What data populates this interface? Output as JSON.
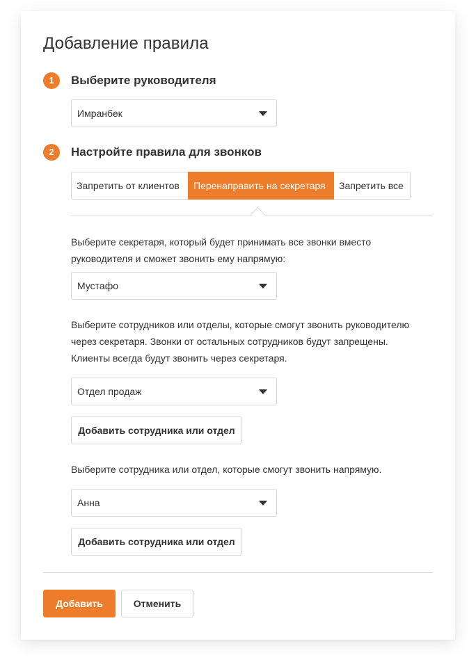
{
  "page": {
    "title": "Добавление правила"
  },
  "step1": {
    "number": "1",
    "title": "Выберите руководителя",
    "manager_select": "Имранбек"
  },
  "step2": {
    "number": "2",
    "title": "Настройте правила для звонков",
    "tabs": [
      {
        "label": "Запретить от клиентов",
        "active": false
      },
      {
        "label": "Перенаправить на секретаря",
        "active": true
      },
      {
        "label": "Запретить все",
        "active": false
      }
    ]
  },
  "secretary": {
    "description": "Выберите секретаря, который будет принимать все звонки вместо\nруководителя и сможет звонить ему напрямую:",
    "select": "Мустафо"
  },
  "via_secretary": {
    "description": "Выберите сотрудников или отделы, которые смогут звонить руководителю\nчерез секретаря.  Звонки от остальных сотрудников будут запрещены.\nКлиенты всегда будут звонить через секретаря.",
    "select": "Отдел продаж",
    "add_button": "Добавить сотрудника или отдел"
  },
  "direct": {
    "description": "Выберите сотрудника или отдел, которые смогут звонить напрямую.",
    "select": "Анна",
    "add_button": "Добавить сотрудника или отдел"
  },
  "footer": {
    "submit_label": "Добавить",
    "cancel_label": "Отменить"
  },
  "colors": {
    "accent": "#ee7d2b",
    "text": "#333333",
    "border": "#d6d6d6"
  },
  "icons": {
    "dropdown": "caret-down-icon"
  }
}
